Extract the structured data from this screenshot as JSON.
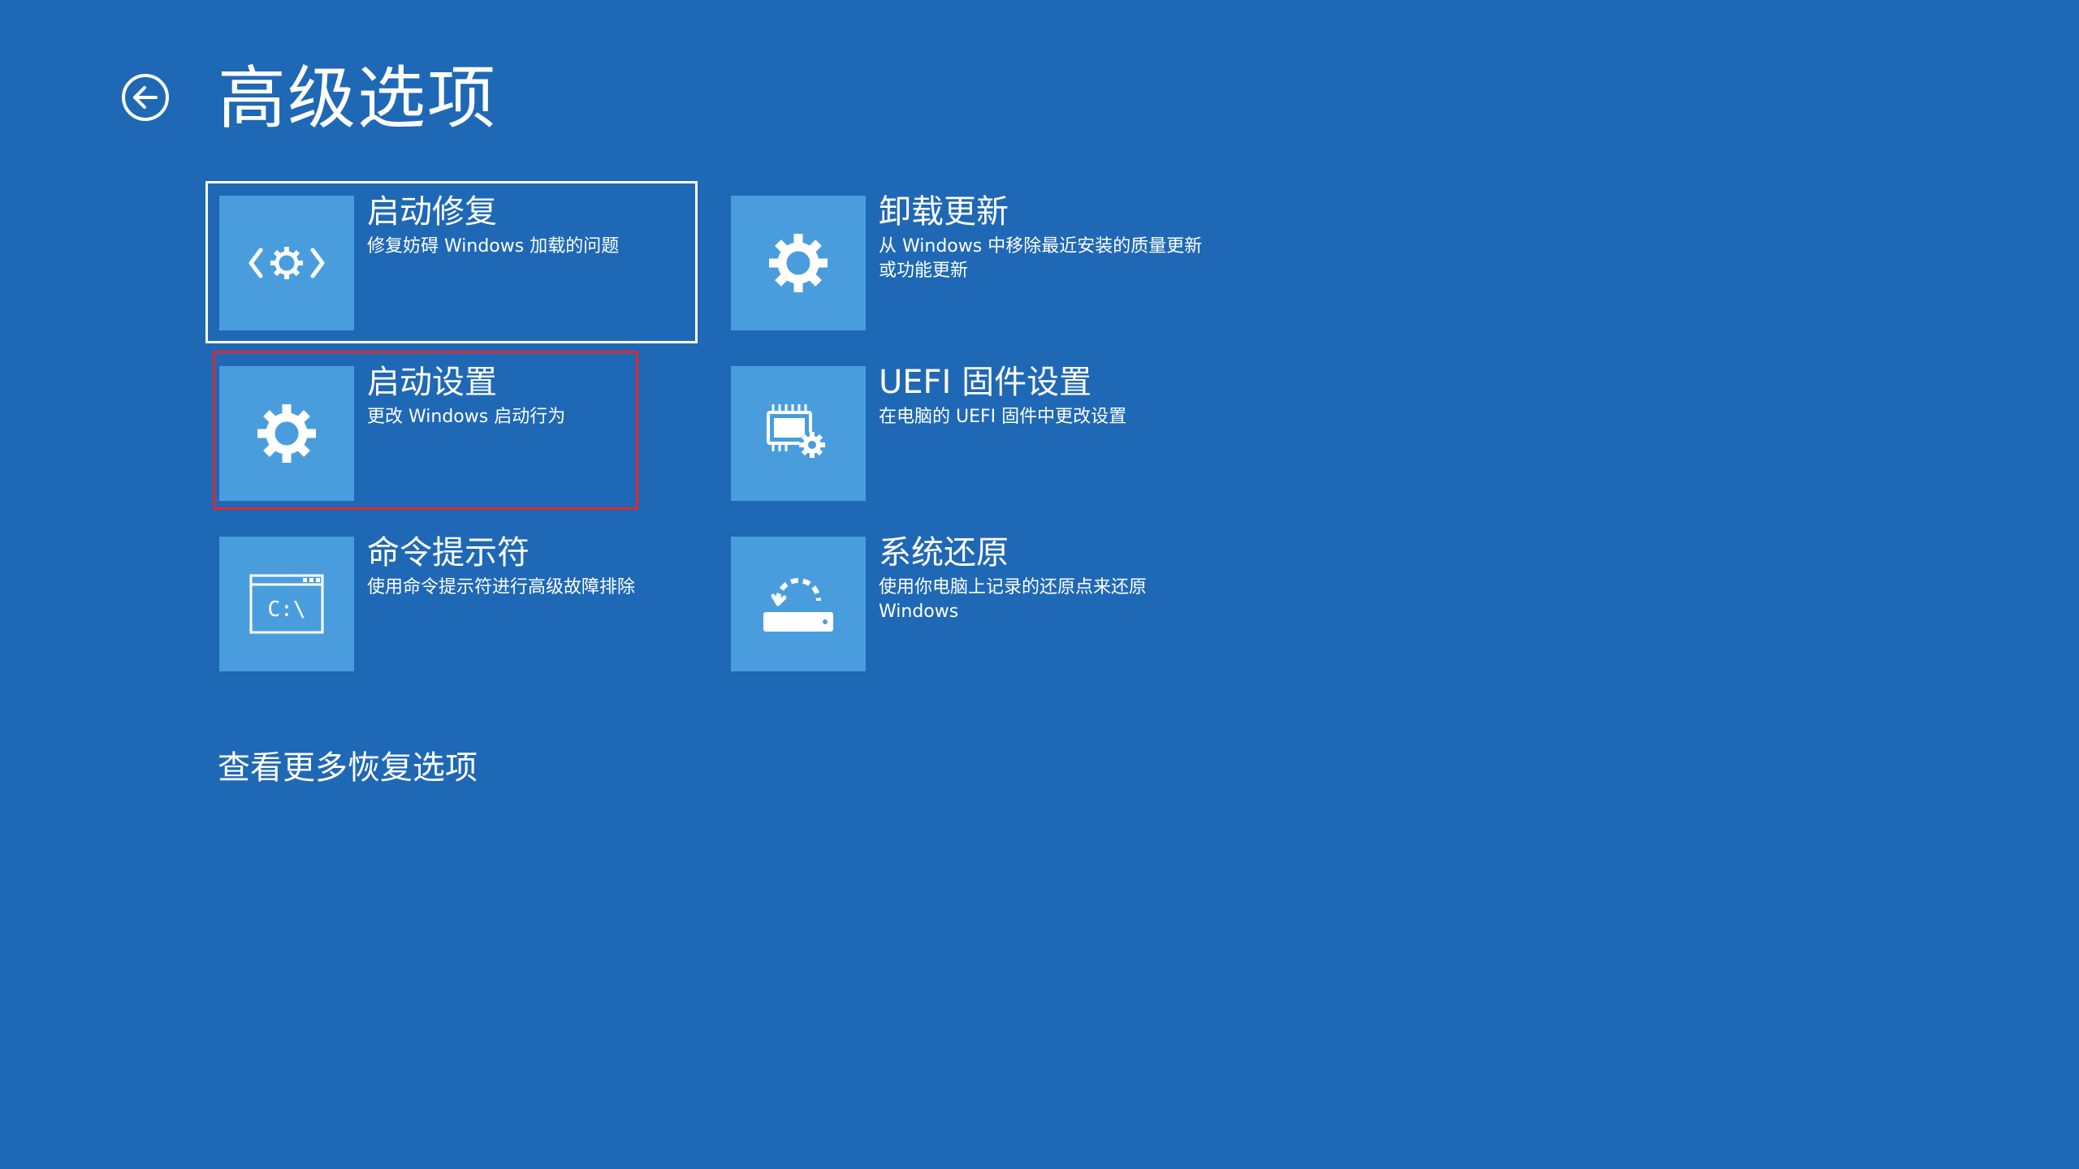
{
  "page": {
    "title": "高级选项",
    "back_icon": "back-arrow-icon",
    "more_options_link": "查看更多恢复选项"
  },
  "colors": {
    "background": "#1f68b5",
    "tile": "#4a9ddd",
    "highlight": "#e0292e"
  },
  "options": [
    {
      "title": "启动修复",
      "description": "修复妨碍 Windows 加载的问题",
      "icon": "startup-repair-icon",
      "selected": true
    },
    {
      "title": "卸载更新",
      "description": "从 Windows 中移除最近安装的质量更新或功能更新",
      "icon": "gear-icon"
    },
    {
      "title": "启动设置",
      "description": "更改 Windows 启动行为",
      "icon": "gear-icon",
      "highlighted": true
    },
    {
      "title": "UEFI 固件设置",
      "description": "在电脑的 UEFI 固件中更改设置",
      "icon": "firmware-settings-icon"
    },
    {
      "title": "命令提示符",
      "description": "使用命令提示符进行高级故障排除",
      "icon": "command-prompt-icon",
      "icon_text": "C:\\"
    },
    {
      "title": "系统还原",
      "description": "使用你电脑上记录的还原点来还原 Windows",
      "icon": "system-restore-icon"
    }
  ]
}
